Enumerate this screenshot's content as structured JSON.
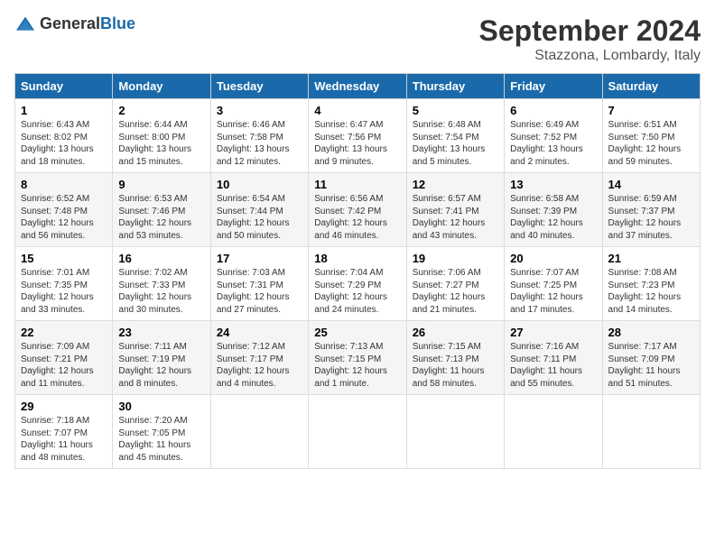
{
  "logo": {
    "text_general": "General",
    "text_blue": "Blue"
  },
  "title": "September 2024",
  "location": "Stazzona, Lombardy, Italy",
  "days_of_week": [
    "Sunday",
    "Monday",
    "Tuesday",
    "Wednesday",
    "Thursday",
    "Friday",
    "Saturday"
  ],
  "weeks": [
    [
      {
        "day": "1",
        "sunrise": "Sunrise: 6:43 AM",
        "sunset": "Sunset: 8:02 PM",
        "daylight": "Daylight: 13 hours and 18 minutes."
      },
      {
        "day": "2",
        "sunrise": "Sunrise: 6:44 AM",
        "sunset": "Sunset: 8:00 PM",
        "daylight": "Daylight: 13 hours and 15 minutes."
      },
      {
        "day": "3",
        "sunrise": "Sunrise: 6:46 AM",
        "sunset": "Sunset: 7:58 PM",
        "daylight": "Daylight: 13 hours and 12 minutes."
      },
      {
        "day": "4",
        "sunrise": "Sunrise: 6:47 AM",
        "sunset": "Sunset: 7:56 PM",
        "daylight": "Daylight: 13 hours and 9 minutes."
      },
      {
        "day": "5",
        "sunrise": "Sunrise: 6:48 AM",
        "sunset": "Sunset: 7:54 PM",
        "daylight": "Daylight: 13 hours and 5 minutes."
      },
      {
        "day": "6",
        "sunrise": "Sunrise: 6:49 AM",
        "sunset": "Sunset: 7:52 PM",
        "daylight": "Daylight: 13 hours and 2 minutes."
      },
      {
        "day": "7",
        "sunrise": "Sunrise: 6:51 AM",
        "sunset": "Sunset: 7:50 PM",
        "daylight": "Daylight: 12 hours and 59 minutes."
      }
    ],
    [
      {
        "day": "8",
        "sunrise": "Sunrise: 6:52 AM",
        "sunset": "Sunset: 7:48 PM",
        "daylight": "Daylight: 12 hours and 56 minutes."
      },
      {
        "day": "9",
        "sunrise": "Sunrise: 6:53 AM",
        "sunset": "Sunset: 7:46 PM",
        "daylight": "Daylight: 12 hours and 53 minutes."
      },
      {
        "day": "10",
        "sunrise": "Sunrise: 6:54 AM",
        "sunset": "Sunset: 7:44 PM",
        "daylight": "Daylight: 12 hours and 50 minutes."
      },
      {
        "day": "11",
        "sunrise": "Sunrise: 6:56 AM",
        "sunset": "Sunset: 7:42 PM",
        "daylight": "Daylight: 12 hours and 46 minutes."
      },
      {
        "day": "12",
        "sunrise": "Sunrise: 6:57 AM",
        "sunset": "Sunset: 7:41 PM",
        "daylight": "Daylight: 12 hours and 43 minutes."
      },
      {
        "day": "13",
        "sunrise": "Sunrise: 6:58 AM",
        "sunset": "Sunset: 7:39 PM",
        "daylight": "Daylight: 12 hours and 40 minutes."
      },
      {
        "day": "14",
        "sunrise": "Sunrise: 6:59 AM",
        "sunset": "Sunset: 7:37 PM",
        "daylight": "Daylight: 12 hours and 37 minutes."
      }
    ],
    [
      {
        "day": "15",
        "sunrise": "Sunrise: 7:01 AM",
        "sunset": "Sunset: 7:35 PM",
        "daylight": "Daylight: 12 hours and 33 minutes."
      },
      {
        "day": "16",
        "sunrise": "Sunrise: 7:02 AM",
        "sunset": "Sunset: 7:33 PM",
        "daylight": "Daylight: 12 hours and 30 minutes."
      },
      {
        "day": "17",
        "sunrise": "Sunrise: 7:03 AM",
        "sunset": "Sunset: 7:31 PM",
        "daylight": "Daylight: 12 hours and 27 minutes."
      },
      {
        "day": "18",
        "sunrise": "Sunrise: 7:04 AM",
        "sunset": "Sunset: 7:29 PM",
        "daylight": "Daylight: 12 hours and 24 minutes."
      },
      {
        "day": "19",
        "sunrise": "Sunrise: 7:06 AM",
        "sunset": "Sunset: 7:27 PM",
        "daylight": "Daylight: 12 hours and 21 minutes."
      },
      {
        "day": "20",
        "sunrise": "Sunrise: 7:07 AM",
        "sunset": "Sunset: 7:25 PM",
        "daylight": "Daylight: 12 hours and 17 minutes."
      },
      {
        "day": "21",
        "sunrise": "Sunrise: 7:08 AM",
        "sunset": "Sunset: 7:23 PM",
        "daylight": "Daylight: 12 hours and 14 minutes."
      }
    ],
    [
      {
        "day": "22",
        "sunrise": "Sunrise: 7:09 AM",
        "sunset": "Sunset: 7:21 PM",
        "daylight": "Daylight: 12 hours and 11 minutes."
      },
      {
        "day": "23",
        "sunrise": "Sunrise: 7:11 AM",
        "sunset": "Sunset: 7:19 PM",
        "daylight": "Daylight: 12 hours and 8 minutes."
      },
      {
        "day": "24",
        "sunrise": "Sunrise: 7:12 AM",
        "sunset": "Sunset: 7:17 PM",
        "daylight": "Daylight: 12 hours and 4 minutes."
      },
      {
        "day": "25",
        "sunrise": "Sunrise: 7:13 AM",
        "sunset": "Sunset: 7:15 PM",
        "daylight": "Daylight: 12 hours and 1 minute."
      },
      {
        "day": "26",
        "sunrise": "Sunrise: 7:15 AM",
        "sunset": "Sunset: 7:13 PM",
        "daylight": "Daylight: 11 hours and 58 minutes."
      },
      {
        "day": "27",
        "sunrise": "Sunrise: 7:16 AM",
        "sunset": "Sunset: 7:11 PM",
        "daylight": "Daylight: 11 hours and 55 minutes."
      },
      {
        "day": "28",
        "sunrise": "Sunrise: 7:17 AM",
        "sunset": "Sunset: 7:09 PM",
        "daylight": "Daylight: 11 hours and 51 minutes."
      }
    ],
    [
      {
        "day": "29",
        "sunrise": "Sunrise: 7:18 AM",
        "sunset": "Sunset: 7:07 PM",
        "daylight": "Daylight: 11 hours and 48 minutes."
      },
      {
        "day": "30",
        "sunrise": "Sunrise: 7:20 AM",
        "sunset": "Sunset: 7:05 PM",
        "daylight": "Daylight: 11 hours and 45 minutes."
      },
      null,
      null,
      null,
      null,
      null
    ]
  ]
}
